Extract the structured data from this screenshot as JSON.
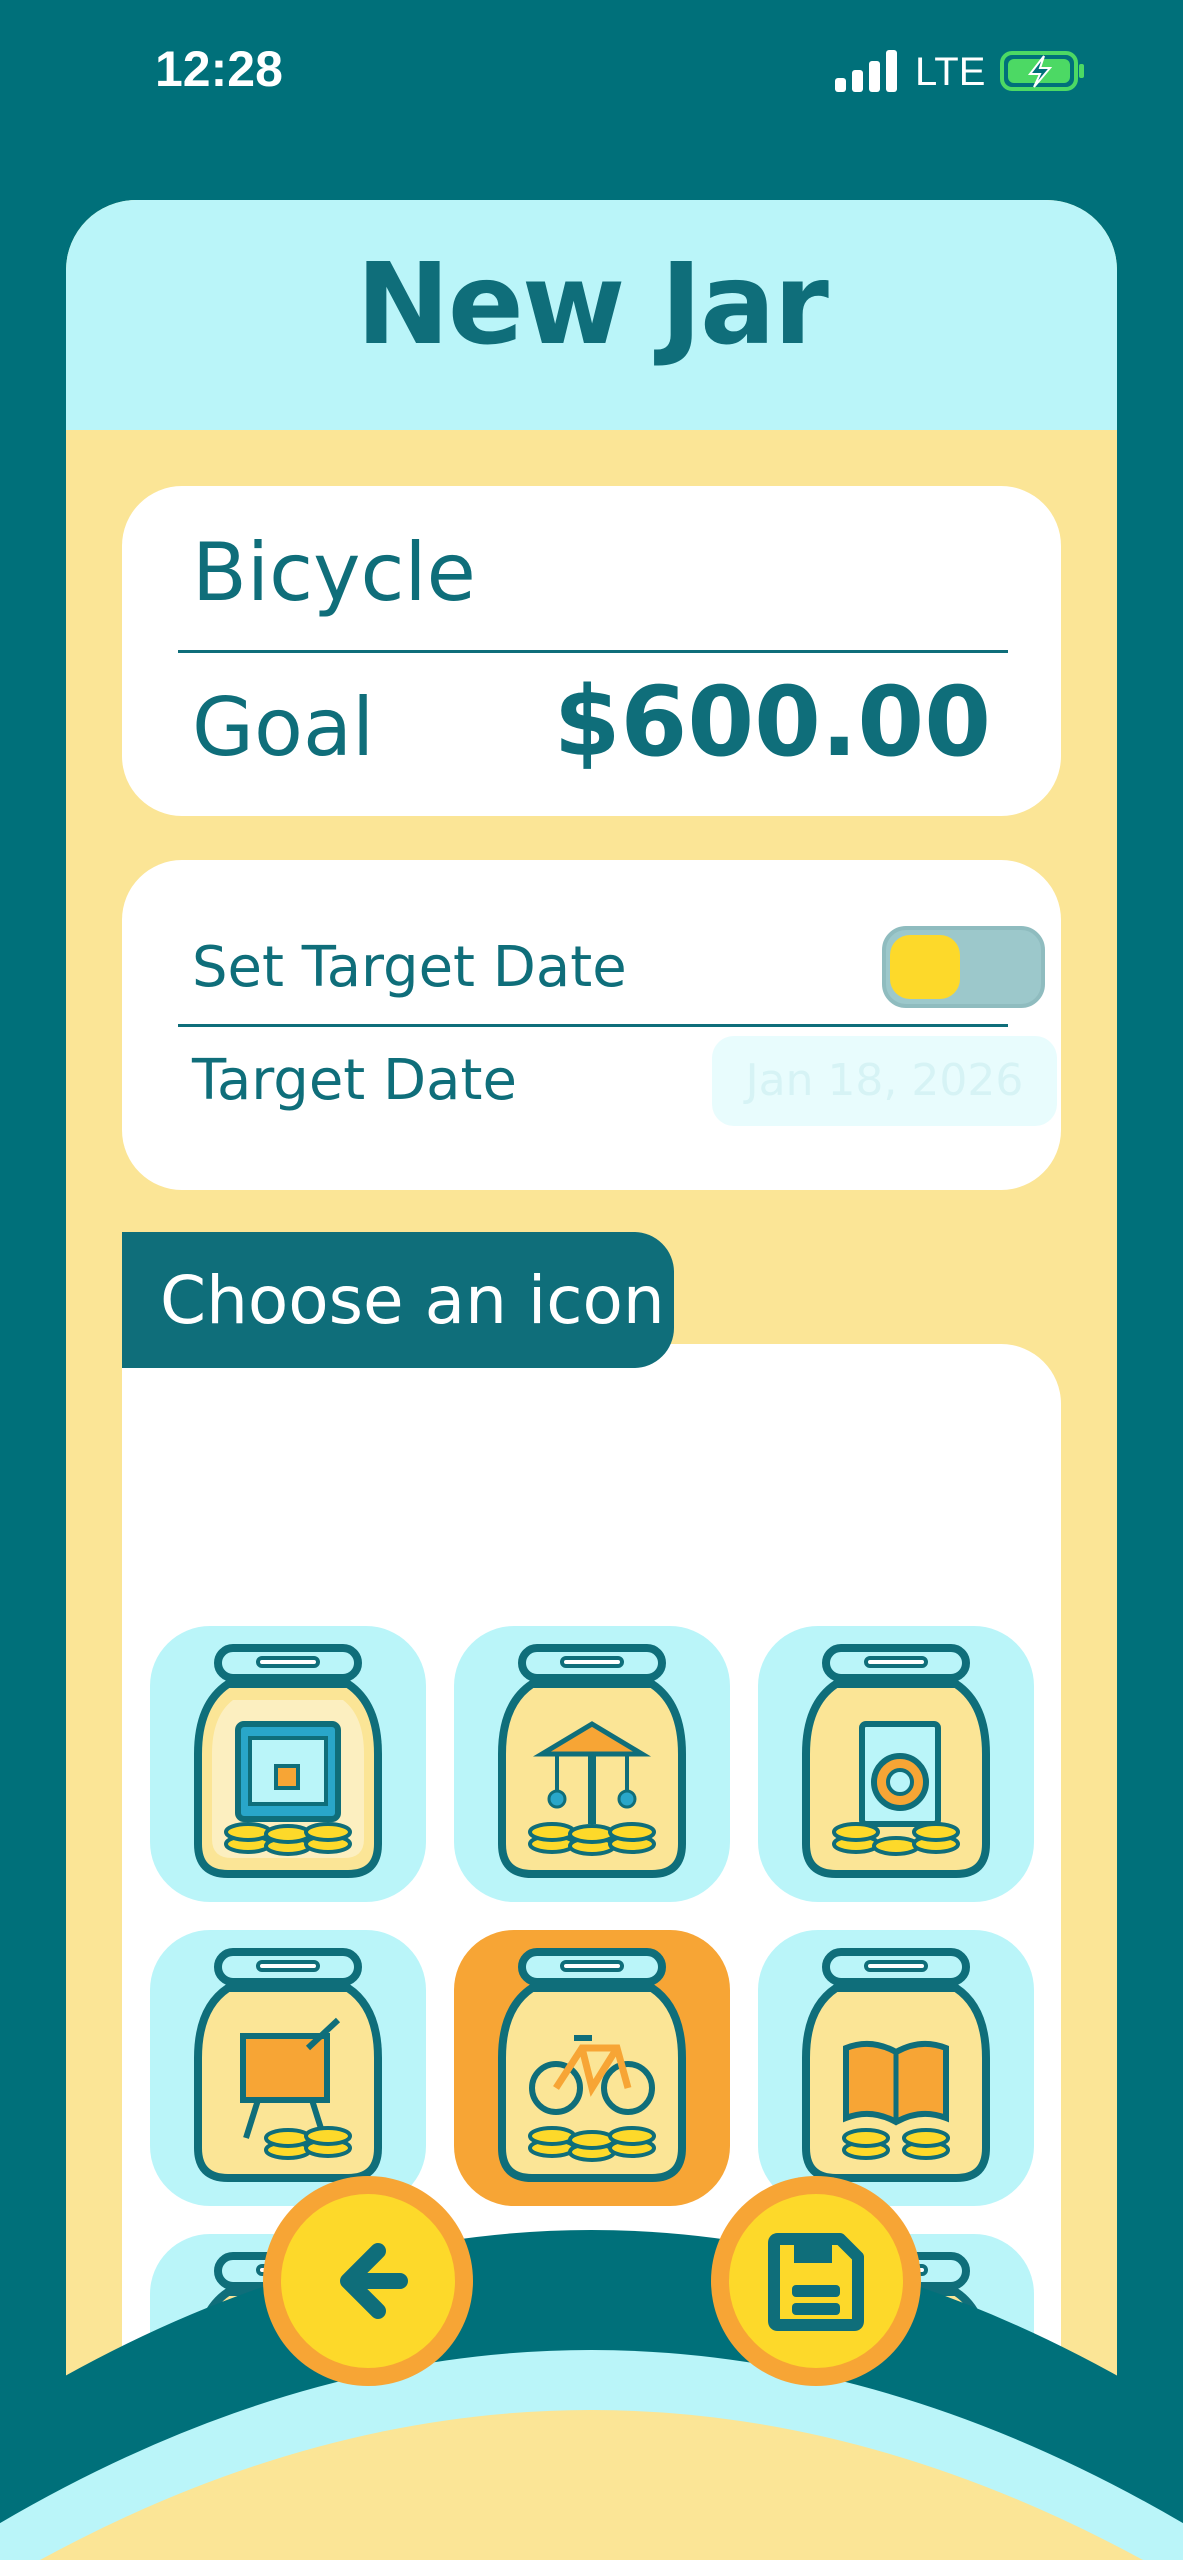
{
  "status_bar": {
    "time": "12:28",
    "network": "LTE"
  },
  "header": {
    "title": "New Jar"
  },
  "jar": {
    "name": "Bicycle",
    "goal_label": "Goal",
    "goal_value": "$600.00"
  },
  "target_date": {
    "toggle_label": "Set Target Date",
    "toggle_on": false,
    "date_label": "Target Date",
    "date_value": "Jan 18, 2026"
  },
  "icon_section": {
    "title": "Choose an icon",
    "icons": [
      {
        "name": "3d-printer-icon",
        "selected": false
      },
      {
        "name": "carousel-icon",
        "selected": false
      },
      {
        "name": "washing-machine-icon",
        "selected": false
      },
      {
        "name": "art-easel-icon",
        "selected": false
      },
      {
        "name": "bicycle-icon",
        "selected": true
      },
      {
        "name": "book-icon",
        "selected": false
      },
      {
        "name": "camera-icon",
        "selected": false
      },
      {
        "name": "tent-icon",
        "selected": false
      },
      {
        "name": "car-icon",
        "selected": false
      }
    ]
  },
  "actions": {
    "back_icon": "arrow-left-icon",
    "save_icon": "save-disk-icon"
  },
  "colors": {
    "teal": "#0f6e7a",
    "background": "#00707a",
    "cream": "#fbe596",
    "light_cyan": "#baf5f9",
    "orange": "#f7a535",
    "yellow": "#fdd92a"
  }
}
